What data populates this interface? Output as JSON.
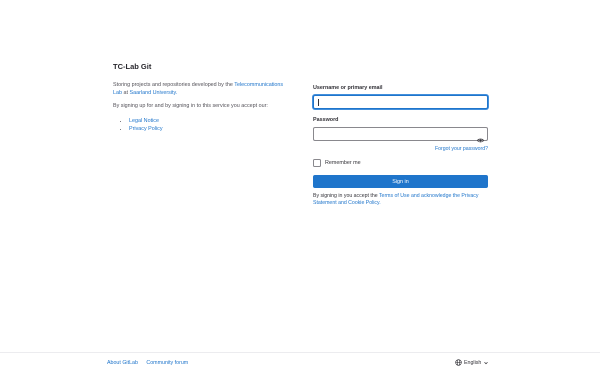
{
  "intro": {
    "title": "TC-Lab Git",
    "description_prefix": "Storing projects and repositories developed by the",
    "lab_link": "Telecommunications Lab",
    "at_text": "at",
    "university_link": "Saarland University.",
    "signup_note": "By signing up for and by signing in to this service you accept our:",
    "links": [
      "Legal Notice",
      "Privacy Policy"
    ]
  },
  "form": {
    "username_label": "Username or primary email",
    "username_value": "",
    "password_label": "Password",
    "password_value": "",
    "forgot_password": "Forgot your password?",
    "remember_me": "Remember me",
    "sign_in": "Sign in",
    "terms_prefix": "By signing in you accept the",
    "terms_link": "Terms of Use and acknowledge the Privacy Statement and Cookie Policy."
  },
  "footer": {
    "about": "About GitLab",
    "forum": "Community forum",
    "language": "English"
  },
  "colors": {
    "link": "#1f75cb",
    "primary_button": "#1f75cb",
    "focus_ring": "#428fdc"
  }
}
